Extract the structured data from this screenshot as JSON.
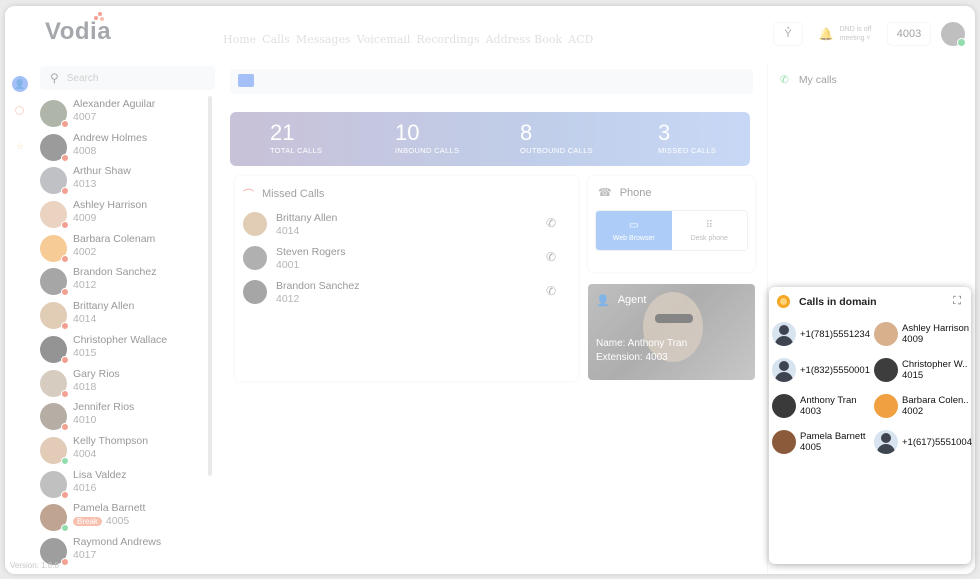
{
  "app": {
    "logo": "Vodia",
    "version": "Version: 1.0.8"
  },
  "nav": [
    "Home",
    "Calls",
    "Messages",
    "Voicemail",
    "Recordings",
    "Address Book",
    "ACD"
  ],
  "header": {
    "dnd_status": "DND is off",
    "dnd_mode": "meeting",
    "extension": "4003"
  },
  "search": {
    "placeholder": "Search"
  },
  "contacts": [
    {
      "name": "Alexander Aguilar",
      "ext": "4007",
      "status": "#e8523a",
      "color": "#6d7a63"
    },
    {
      "name": "Andrew Holmes",
      "ext": "4008",
      "status": "#e8523a",
      "color": "#4a4a4a"
    },
    {
      "name": "Arthur Shaw",
      "ext": "4013",
      "status": "#e8523a",
      "color": "#8a8f96"
    },
    {
      "name": "Ashley Harrison",
      "ext": "4009",
      "status": "#e8523a",
      "color": "#d9b08c"
    },
    {
      "name": "Barbara Colenam",
      "ext": "4002",
      "status": "#e8523a",
      "color": "#f0a040"
    },
    {
      "name": "Brandon Sanchez",
      "ext": "4012",
      "status": "#e8523a",
      "color": "#5e5e5e"
    },
    {
      "name": "Brittany Allen",
      "ext": "4014",
      "status": "#e8523a",
      "color": "#c9a27a"
    },
    {
      "name": "Christopher Wallace",
      "ext": "4015",
      "status": "#e8523a",
      "color": "#3d3d3d"
    },
    {
      "name": "Gary Rios",
      "ext": "4018",
      "status": "#e8523a",
      "color": "#b4a48c"
    },
    {
      "name": "Jennifer Rios",
      "ext": "4010",
      "status": "#e8523a",
      "color": "#7a6a5a"
    },
    {
      "name": "Kelly Thompson",
      "ext": "4004",
      "status": "#3bbf6a",
      "color": "#caa07d"
    },
    {
      "name": "Lisa Valdez",
      "ext": "4016",
      "status": "#e8523a",
      "color": "#8d8d8d"
    },
    {
      "name": "Pamela Barnett",
      "ext": "4005",
      "status": "#3bbf6a",
      "color": "#8a5a3a",
      "badge": "Break"
    },
    {
      "name": "Raymond Andrews",
      "ext": "4017",
      "status": "#e8523a",
      "color": "#4f4f4f"
    }
  ],
  "stats": [
    {
      "value": "21",
      "label": "TOTAL CALLS"
    },
    {
      "value": "10",
      "label": "INBOUND CALLS"
    },
    {
      "value": "8",
      "label": "OUTBOUND CALLS"
    },
    {
      "value": "3",
      "label": "MISSED CALLS"
    }
  ],
  "missed_calls": {
    "title": "Missed Calls",
    "items": [
      {
        "name": "Brittany Allen",
        "ext": "4014",
        "color": "#c9a27a"
      },
      {
        "name": "Steven Rogers",
        "ext": "4001",
        "color": "#6f6f6f"
      },
      {
        "name": "Brandon Sanchez",
        "ext": "4012",
        "color": "#5e5e5e"
      }
    ]
  },
  "phone": {
    "title": "Phone",
    "web_browser": "Web Browser",
    "desk_phone": "Desk phone"
  },
  "agent": {
    "title": "Agent",
    "name_line": "Name: Anthony Tran",
    "ext_line": "Extension: 4003"
  },
  "my_calls": {
    "title": "My calls"
  },
  "domain_calls": {
    "title": "Calls in domain",
    "left": [
      {
        "line1": "+1(781)5551234",
        "line2": "",
        "avatar": "silhouette"
      },
      {
        "line1": "+1(832)5550001",
        "line2": "",
        "avatar": "silhouette"
      },
      {
        "line1": "Anthony Tran",
        "line2": "4003",
        "avatar": "#3a3a3a"
      },
      {
        "line1": "Pamela Barnett",
        "line2": "4005",
        "avatar": "#8a5a3a"
      }
    ],
    "right": [
      {
        "line1": "Ashley Harrison",
        "line2": "4009",
        "avatar": "#d9b08c"
      },
      {
        "line1": "Christopher W..",
        "line2": "4015",
        "avatar": "#3d3d3d"
      },
      {
        "line1": "Barbara Colen..",
        "line2": "4002",
        "avatar": "#f0a040"
      },
      {
        "line1": "+1(617)5551004",
        "line2": "",
        "avatar": "silhouette"
      }
    ]
  }
}
